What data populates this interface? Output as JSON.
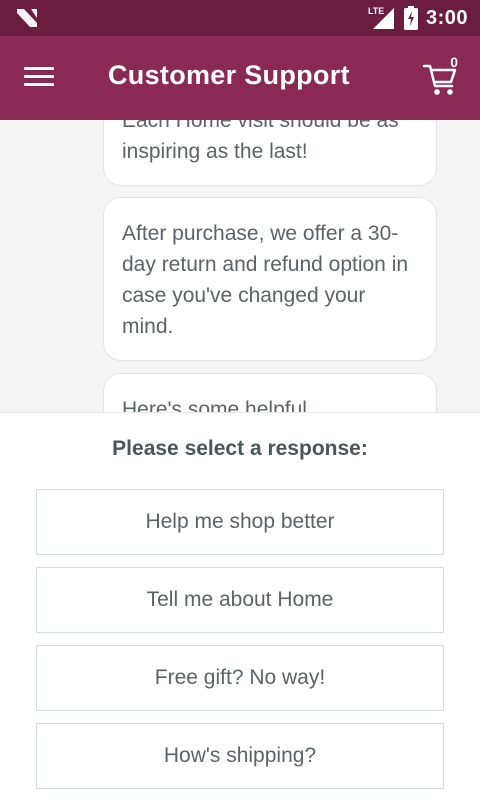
{
  "status_bar": {
    "network": "LTE",
    "time": "3:00",
    "icons": [
      "n-logo-icon",
      "signal-icon",
      "battery-icon"
    ]
  },
  "app_bar": {
    "title": "Customer Support",
    "menu_icon": "hamburger-menu-icon",
    "cart_icon": "cart-icon",
    "cart_count": "0"
  },
  "chat": {
    "messages": [
      {
        "text": "Each Home visit should be as inspiring as the last!"
      },
      {
        "text": "After purchase, we offer a 30-day return and refund option in case you've changed your mind."
      },
      {
        "text": "Here's some helpful"
      }
    ]
  },
  "response_panel": {
    "prompt": "Please select a response:",
    "options": [
      {
        "label": "Help me shop better"
      },
      {
        "label": "Tell me about Home"
      },
      {
        "label": "Free gift? No way!"
      },
      {
        "label": "How's shipping?"
      }
    ]
  },
  "colors": {
    "status_bar": "#6b1d3f",
    "app_bar": "#8a2a54",
    "chat_background": "#f4f4f5",
    "text": "#5a6468"
  }
}
